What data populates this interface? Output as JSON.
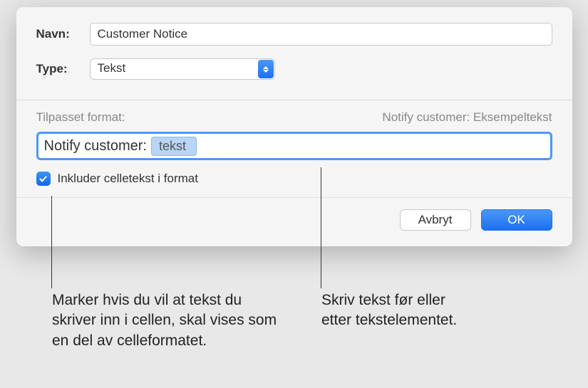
{
  "form": {
    "name_label": "Navn:",
    "name_value": "Customer Notice",
    "type_label": "Type:",
    "type_value": "Tekst"
  },
  "format": {
    "header_left": "Tilpasset format:",
    "header_right": "Notify customer: Eksempeltekst",
    "prefix": "Notify customer:",
    "token": "tekst",
    "checkbox_label": "Inkluder celletekst i format",
    "checkbox_checked": true
  },
  "buttons": {
    "cancel": "Avbryt",
    "ok": "OK"
  },
  "callouts": {
    "left": "Marker hvis du vil at tekst du skriver inn i cellen, skal vises som en del av celleformatet.",
    "right": "Skriv tekst før eller etter tekstelementet."
  }
}
